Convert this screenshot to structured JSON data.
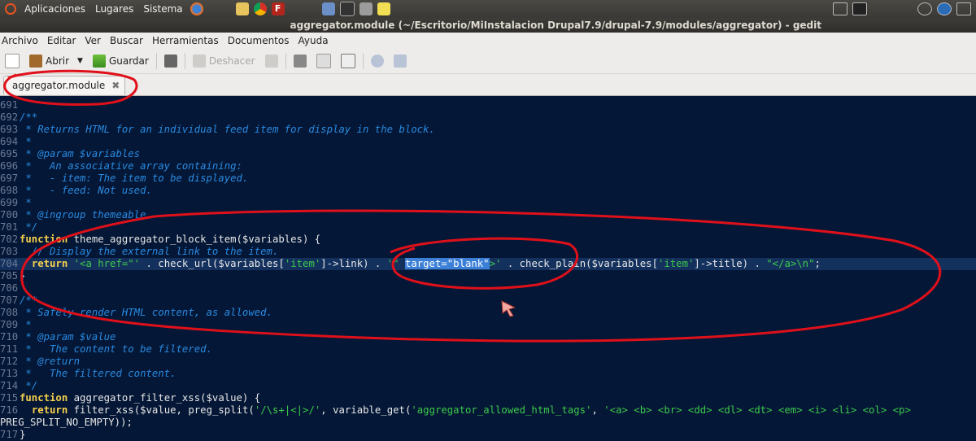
{
  "top_panel": {
    "menus": [
      "Aplicaciones",
      "Lugares",
      "Sistema"
    ],
    "launcher_icons": [
      "firefox-icon",
      "folder-icon",
      "chrome-icon",
      "filezilla-icon"
    ],
    "dev_icons": [
      "virtualbox-icon",
      "terminal-icon",
      "screenshot-icon",
      "notes-icon"
    ]
  },
  "window_title": "aggregator.module (~/Escritorio/MiInstalacion Drupal7.9/drupal-7.9/modules/aggregator) - gedit",
  "menubar": [
    {
      "name": "archivo",
      "label": "Archivo"
    },
    {
      "name": "editar",
      "label": "Editar"
    },
    {
      "name": "ver",
      "label": "Ver"
    },
    {
      "name": "buscar",
      "label": "Buscar"
    },
    {
      "name": "herramientas",
      "label": "Herramientas"
    },
    {
      "name": "documentos",
      "label": "Documentos"
    },
    {
      "name": "ayuda",
      "label": "Ayuda"
    }
  ],
  "toolbar": {
    "open_label": "Abrir",
    "save_label": "Guardar",
    "undo_label": "Deshacer"
  },
  "tab": {
    "label": "aggregator.module",
    "close": "✖"
  },
  "colors": {
    "annotation": "#e0101a",
    "editor_bg": "#041736",
    "selection": "#3b7fd6"
  },
  "code": {
    "lines": [
      {
        "n": "691",
        "t": ""
      },
      {
        "n": "692",
        "t": "/**"
      },
      {
        "n": "693",
        "t": " * Returns HTML for an individual feed item for display in the block."
      },
      {
        "n": "694",
        "t": " *"
      },
      {
        "n": "695",
        "t": " * @param $variables"
      },
      {
        "n": "696",
        "t": " *   An associative array containing:"
      },
      {
        "n": "697",
        "t": " *   - item: The item to be displayed."
      },
      {
        "n": "698",
        "t": " *   - feed: Not used."
      },
      {
        "n": "699",
        "t": " *"
      },
      {
        "n": "700",
        "t": " * @ingroup themeable"
      },
      {
        "n": "701",
        "t": " */"
      },
      {
        "n": "702",
        "t": "function theme_aggregator_block_item($variables) {"
      },
      {
        "n": "703",
        "t": "  // Display the external link to the item."
      },
      {
        "n": "704",
        "t": "  return '<a href=\"' . check_url($variables['item']->link) . '\" target=\"blank\">' . check_plain($variables['item']->title) . \"</a>\\n\";"
      },
      {
        "n": "705",
        "t": "}"
      },
      {
        "n": "706",
        "t": ""
      },
      {
        "n": "707",
        "t": "/**"
      },
      {
        "n": "708",
        "t": " * Safely render HTML content, as allowed."
      },
      {
        "n": "709",
        "t": " *"
      },
      {
        "n": "710",
        "t": " * @param $value"
      },
      {
        "n": "711",
        "t": " *   The content to be filtered."
      },
      {
        "n": "712",
        "t": " * @return"
      },
      {
        "n": "713",
        "t": " *   The filtered content."
      },
      {
        "n": "714",
        "t": " */"
      },
      {
        "n": "715",
        "t": "function aggregator_filter_xss($value) {"
      },
      {
        "n": "716",
        "t": "  return filter_xss($value, preg_split('/\\s+|<|>/', variable_get('aggregator_allowed_html_tags', '<a> <b> <br> <dd> <dl> <dt> <em> <i> <li> <ol> <p>"
      },
      {
        "n": "",
        "t": "PREG_SPLIT_NO_EMPTY));"
      },
      {
        "n": "717",
        "t": "}"
      }
    ],
    "selected_text": "target=\"blank\""
  }
}
